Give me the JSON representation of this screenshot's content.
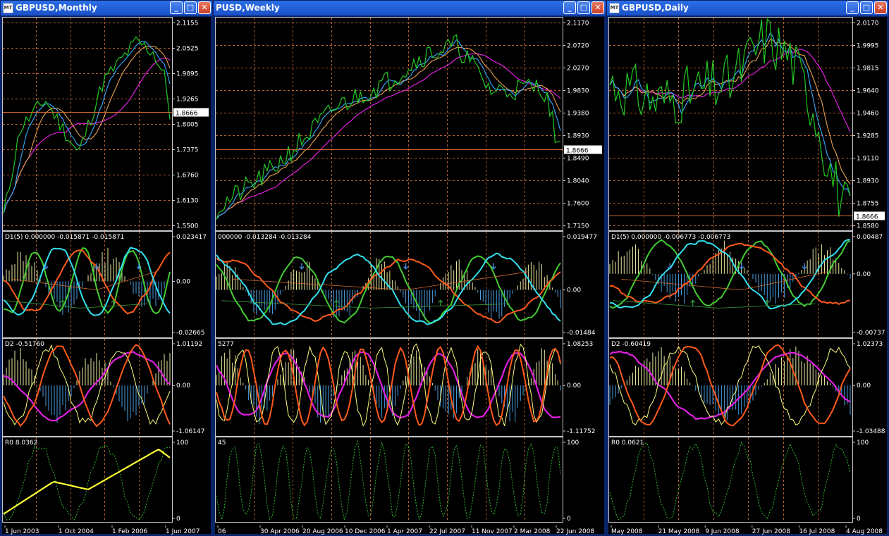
{
  "windows": [
    {
      "id": "monthly",
      "title": "GBPUSD,Monthly",
      "current_price": "1.8666",
      "main_scale": [
        "2.1155",
        "2.0525",
        "1.9895",
        "1.9265",
        "1.8005",
        "1.7375",
        "1.6760",
        "1.6130",
        "1.5500"
      ],
      "ind1_label": "D1(5) 0.000000 -0.015871 -0.015871",
      "ind1_scale": [
        "0.023417",
        "0.00",
        "-0.02665"
      ],
      "ind2_label": "D2 -0.51760",
      "ind2_scale": [
        "1.01192",
        "0.00",
        "-1.06147"
      ],
      "ind3_label": "R0 8.0362",
      "ind3_scale": [
        "100",
        "0"
      ],
      "time_labels": [
        "1 Jun 2003",
        "1 Oct 2004",
        "1 Feb 2006",
        "1 Jun 2007"
      ]
    },
    {
      "id": "weekly",
      "title": "PUSD,Weekly",
      "current_price": "1.8666",
      "main_scale": [
        "2.1170",
        "2.0720",
        "2.0270",
        "1.9830",
        "1.9380",
        "1.8930",
        "1.8490",
        "1.8040",
        "1.7600",
        "1.7150"
      ],
      "ind1_label": "000000 -0.013284 -0.013284",
      "ind1_scale": [
        "0.019477",
        "0.00",
        "-0.01484"
      ],
      "ind2_label": "5277",
      "ind2_scale": [
        "1.08253",
        "0.00",
        "-1.11752"
      ],
      "ind3_label": "45",
      "ind3_scale": [
        "100",
        "0"
      ],
      "time_labels": [
        "06",
        "30 Apr 2006",
        "20 Aug 2006",
        "10 Dec 2006",
        "1 Apr 2007",
        "22 Jul 2007",
        "11 Nov 2007",
        "2 Mar 2008",
        "22 Jun 2008"
      ]
    },
    {
      "id": "daily",
      "title": "GBPUSD,Daily",
      "current_price": "1.8666",
      "main_scale": [
        "2.0170",
        "1.9995",
        "1.9815",
        "1.9640",
        "1.9460",
        "1.9285",
        "1.9110",
        "1.8930",
        "1.8755",
        "1.8580"
      ],
      "ind1_label": "D1(5) 0.000000 -0.006773 -0.006773",
      "ind1_scale": [
        "0.00487",
        "0.00",
        "-0.00737"
      ],
      "ind2_label": "D2 -0.60419",
      "ind2_scale": [
        "1.02373",
        "0.00",
        "-1.03488"
      ],
      "ind3_label": "R0 0.0621",
      "ind3_scale": [
        "100",
        "0"
      ],
      "time_labels": [
        "May 2008",
        "21 May 2008",
        "9 Jun 2008",
        "27 Jun 2008",
        "16 Jul 2008",
        "4 Aug 2008"
      ]
    }
  ],
  "colors": {
    "price": "#22c922",
    "ma_fast": "#33aaff",
    "ma_mid": "#e8a050",
    "ma_slow": "#e020e0",
    "cyan": "#33e0ee",
    "orange": "#ff5a1a",
    "green": "#44cc33",
    "yellow": "#ffff33",
    "hist_pos": "#e8e8a0",
    "hist_neg": "#4a9ee0",
    "grid": "#b06030",
    "title_bg": "#1f5ad6"
  }
}
